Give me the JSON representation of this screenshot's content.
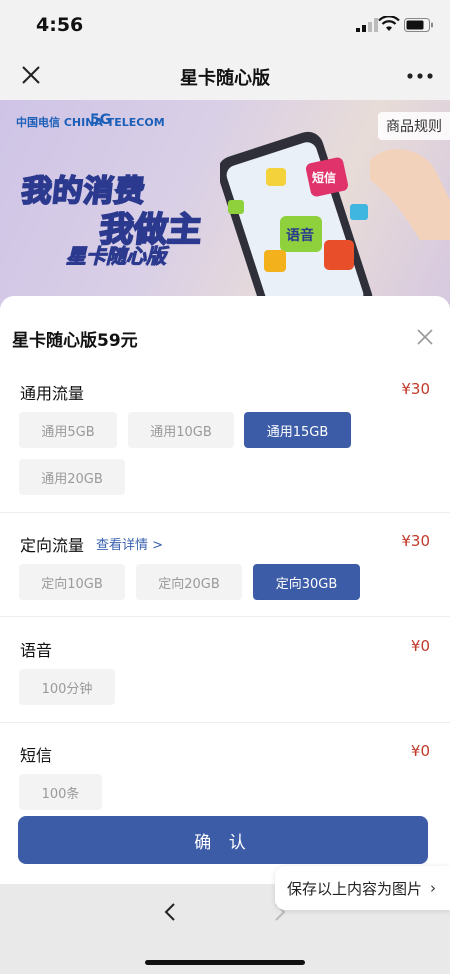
{
  "status_bar": {
    "time": "4:56"
  },
  "nav": {
    "title": "星卡随心版"
  },
  "banner": {
    "brand": "中国电信 CHINA TELECOM",
    "brand_5g": "5G",
    "slogan_line1": "我的消费",
    "slogan_line2": "我做主",
    "product": "星卡随心版",
    "rule_label": "商品规则",
    "puzzle_voice": "语音",
    "puzzle_sms": "短信"
  },
  "sheet": {
    "title": "星卡随心版59元",
    "sections": [
      {
        "label": "通用流量",
        "price": "¥30",
        "options": [
          {
            "label": "通用5GB",
            "selected": false
          },
          {
            "label": "通用10GB",
            "selected": false
          },
          {
            "label": "通用15GB",
            "selected": true
          },
          {
            "label": "通用20GB",
            "selected": false
          }
        ]
      },
      {
        "label": "定向流量",
        "price": "¥30",
        "link": "查看详情 >",
        "options": [
          {
            "label": "定向10GB",
            "selected": false
          },
          {
            "label": "定向20GB",
            "selected": false
          },
          {
            "label": "定向30GB",
            "selected": true
          }
        ]
      },
      {
        "label": "语音",
        "price": "¥0",
        "options": [
          {
            "label": "100分钟",
            "selected": false
          }
        ]
      },
      {
        "label": "短信",
        "price": "¥0",
        "options": [
          {
            "label": "100条",
            "selected": false
          }
        ]
      }
    ],
    "confirm_label": "确 认"
  },
  "save_tip": {
    "label": "保存以上内容为图片",
    "chevron": "›"
  },
  "colors": {
    "accent": "#3d5ca8",
    "price": "#c0392b",
    "option_bg": "#f3f3f3"
  }
}
